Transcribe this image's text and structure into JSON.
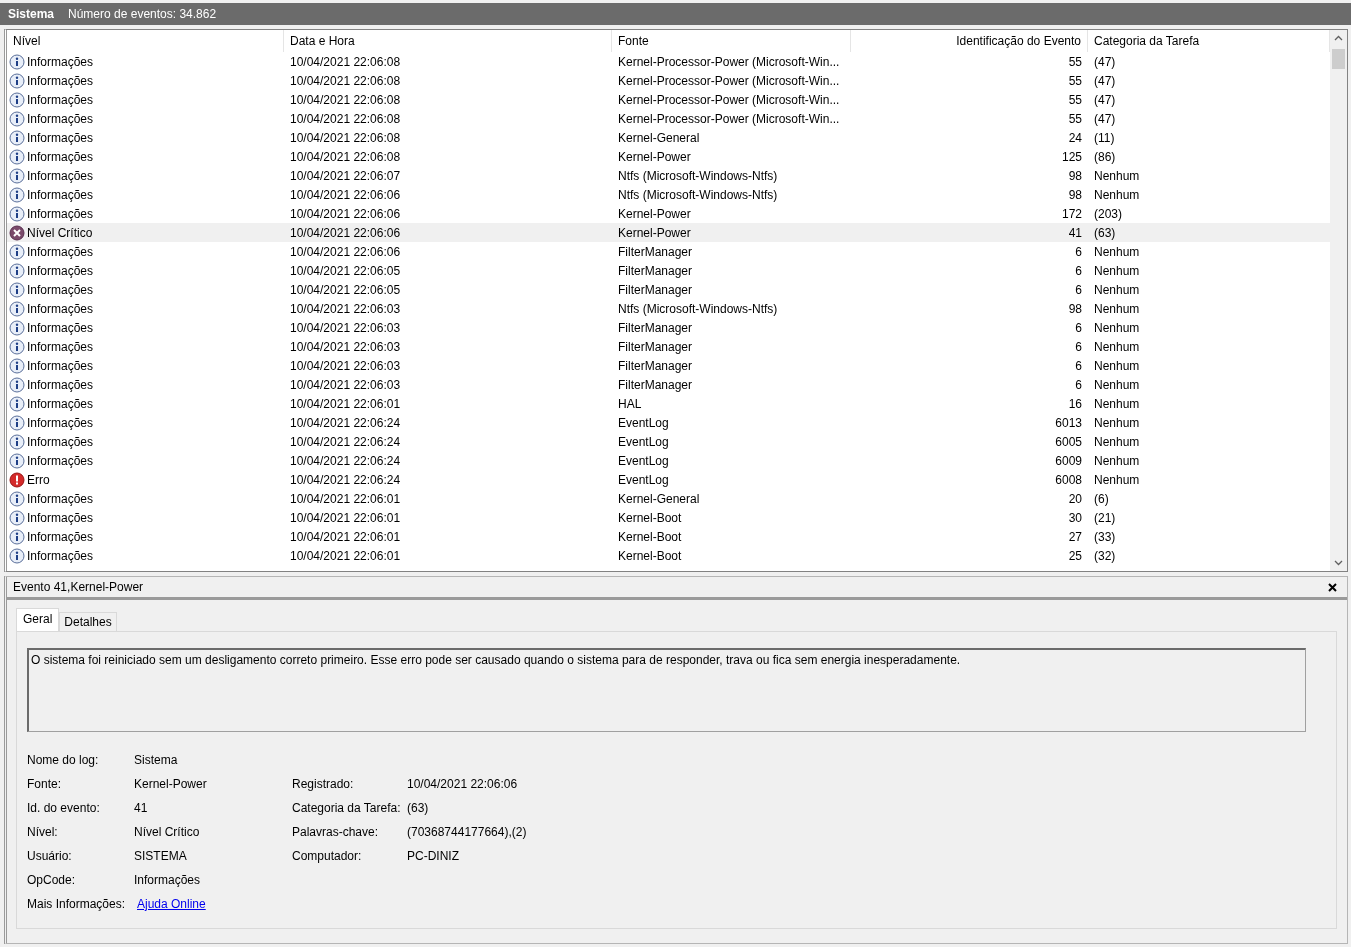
{
  "header": {
    "log_name": "Sistema",
    "event_count": "Número de eventos: 34.862"
  },
  "table": {
    "columns": [
      "Nível",
      "Data e Hora",
      "Fonte",
      "Identificação do Evento",
      "Categoria da Tarefa"
    ],
    "rows": [
      {
        "kind": "info",
        "level": "Informações",
        "date": "10/04/2021 22:06:08",
        "source": "Kernel-Processor-Power (Microsoft-Win...",
        "id": "55",
        "category": "(47)",
        "selected": false
      },
      {
        "kind": "info",
        "level": "Informações",
        "date": "10/04/2021 22:06:08",
        "source": "Kernel-Processor-Power (Microsoft-Win...",
        "id": "55",
        "category": "(47)",
        "selected": false
      },
      {
        "kind": "info",
        "level": "Informações",
        "date": "10/04/2021 22:06:08",
        "source": "Kernel-Processor-Power (Microsoft-Win...",
        "id": "55",
        "category": "(47)",
        "selected": false
      },
      {
        "kind": "info",
        "level": "Informações",
        "date": "10/04/2021 22:06:08",
        "source": "Kernel-Processor-Power (Microsoft-Win...",
        "id": "55",
        "category": "(47)",
        "selected": false
      },
      {
        "kind": "info",
        "level": "Informações",
        "date": "10/04/2021 22:06:08",
        "source": "Kernel-General",
        "id": "24",
        "category": "(11)",
        "selected": false
      },
      {
        "kind": "info",
        "level": "Informações",
        "date": "10/04/2021 22:06:08",
        "source": "Kernel-Power",
        "id": "125",
        "category": "(86)",
        "selected": false
      },
      {
        "kind": "info",
        "level": "Informações",
        "date": "10/04/2021 22:06:07",
        "source": "Ntfs (Microsoft-Windows-Ntfs)",
        "id": "98",
        "category": "Nenhum",
        "selected": false
      },
      {
        "kind": "info",
        "level": "Informações",
        "date": "10/04/2021 22:06:06",
        "source": "Ntfs (Microsoft-Windows-Ntfs)",
        "id": "98",
        "category": "Nenhum",
        "selected": false
      },
      {
        "kind": "info",
        "level": "Informações",
        "date": "10/04/2021 22:06:06",
        "source": "Kernel-Power",
        "id": "172",
        "category": "(203)",
        "selected": false
      },
      {
        "kind": "critical",
        "level": "Nível Crítico",
        "date": "10/04/2021 22:06:06",
        "source": "Kernel-Power",
        "id": "41",
        "category": "(63)",
        "selected": true
      },
      {
        "kind": "info",
        "level": "Informações",
        "date": "10/04/2021 22:06:06",
        "source": "FilterManager",
        "id": "6",
        "category": "Nenhum",
        "selected": false
      },
      {
        "kind": "info",
        "level": "Informações",
        "date": "10/04/2021 22:06:05",
        "source": "FilterManager",
        "id": "6",
        "category": "Nenhum",
        "selected": false
      },
      {
        "kind": "info",
        "level": "Informações",
        "date": "10/04/2021 22:06:05",
        "source": "FilterManager",
        "id": "6",
        "category": "Nenhum",
        "selected": false
      },
      {
        "kind": "info",
        "level": "Informações",
        "date": "10/04/2021 22:06:03",
        "source": "Ntfs (Microsoft-Windows-Ntfs)",
        "id": "98",
        "category": "Nenhum",
        "selected": false
      },
      {
        "kind": "info",
        "level": "Informações",
        "date": "10/04/2021 22:06:03",
        "source": "FilterManager",
        "id": "6",
        "category": "Nenhum",
        "selected": false
      },
      {
        "kind": "info",
        "level": "Informações",
        "date": "10/04/2021 22:06:03",
        "source": "FilterManager",
        "id": "6",
        "category": "Nenhum",
        "selected": false
      },
      {
        "kind": "info",
        "level": "Informações",
        "date": "10/04/2021 22:06:03",
        "source": "FilterManager",
        "id": "6",
        "category": "Nenhum",
        "selected": false
      },
      {
        "kind": "info",
        "level": "Informações",
        "date": "10/04/2021 22:06:03",
        "source": "FilterManager",
        "id": "6",
        "category": "Nenhum",
        "selected": false
      },
      {
        "kind": "info",
        "level": "Informações",
        "date": "10/04/2021 22:06:01",
        "source": "HAL",
        "id": "16",
        "category": "Nenhum",
        "selected": false
      },
      {
        "kind": "info",
        "level": "Informações",
        "date": "10/04/2021 22:06:24",
        "source": "EventLog",
        "id": "6013",
        "category": "Nenhum",
        "selected": false
      },
      {
        "kind": "info",
        "level": "Informações",
        "date": "10/04/2021 22:06:24",
        "source": "EventLog",
        "id": "6005",
        "category": "Nenhum",
        "selected": false
      },
      {
        "kind": "info",
        "level": "Informações",
        "date": "10/04/2021 22:06:24",
        "source": "EventLog",
        "id": "6009",
        "category": "Nenhum",
        "selected": false
      },
      {
        "kind": "error",
        "level": "Erro",
        "date": "10/04/2021 22:06:24",
        "source": "EventLog",
        "id": "6008",
        "category": "Nenhum",
        "selected": false
      },
      {
        "kind": "info",
        "level": "Informações",
        "date": "10/04/2021 22:06:01",
        "source": "Kernel-General",
        "id": "20",
        "category": "(6)",
        "selected": false
      },
      {
        "kind": "info",
        "level": "Informações",
        "date": "10/04/2021 22:06:01",
        "source": "Kernel-Boot",
        "id": "30",
        "category": "(21)",
        "selected": false
      },
      {
        "kind": "info",
        "level": "Informações",
        "date": "10/04/2021 22:06:01",
        "source": "Kernel-Boot",
        "id": "27",
        "category": "(33)",
        "selected": false
      },
      {
        "kind": "info",
        "level": "Informações",
        "date": "10/04/2021 22:06:01",
        "source": "Kernel-Boot",
        "id": "25",
        "category": "(32)",
        "selected": false
      }
    ]
  },
  "detail": {
    "title": "Evento 41,Kernel-Power",
    "tabs": [
      {
        "label": "Geral",
        "selected": true
      },
      {
        "label": "Detalhes",
        "selected": false
      }
    ],
    "description": "O sistema foi reiniciado sem um desligamento correto primeiro. Esse erro pode ser causado quando o sistema para de responder, trava ou fica sem energia inesperadamente.",
    "fields_left": [
      {
        "label": "Nome do log:",
        "value": "Sistema",
        "kind": "text"
      },
      {
        "label": "Fonte:",
        "value": "Kernel-Power",
        "kind": "text"
      },
      {
        "label": "Id. do evento:",
        "value": "41",
        "kind": "text"
      },
      {
        "label": "Nível:",
        "value": "Nível Crítico",
        "kind": "text"
      },
      {
        "label": "Usuário:",
        "value": "SISTEMA",
        "kind": "text"
      },
      {
        "label": "OpCode:",
        "value": "Informações",
        "kind": "text"
      },
      {
        "label": "Mais Informações:",
        "value": "Ajuda Online",
        "kind": "link"
      }
    ],
    "fields_right": [
      {
        "label": "Registrado:",
        "value": "10/04/2021 22:06:06"
      },
      {
        "label": "Categoria da Tarefa:",
        "value": "(63)"
      },
      {
        "label": "Palavras-chave:",
        "value": "(70368744177664),(2)"
      },
      {
        "label": "Computador:",
        "value": "PC-DINIZ"
      }
    ]
  }
}
